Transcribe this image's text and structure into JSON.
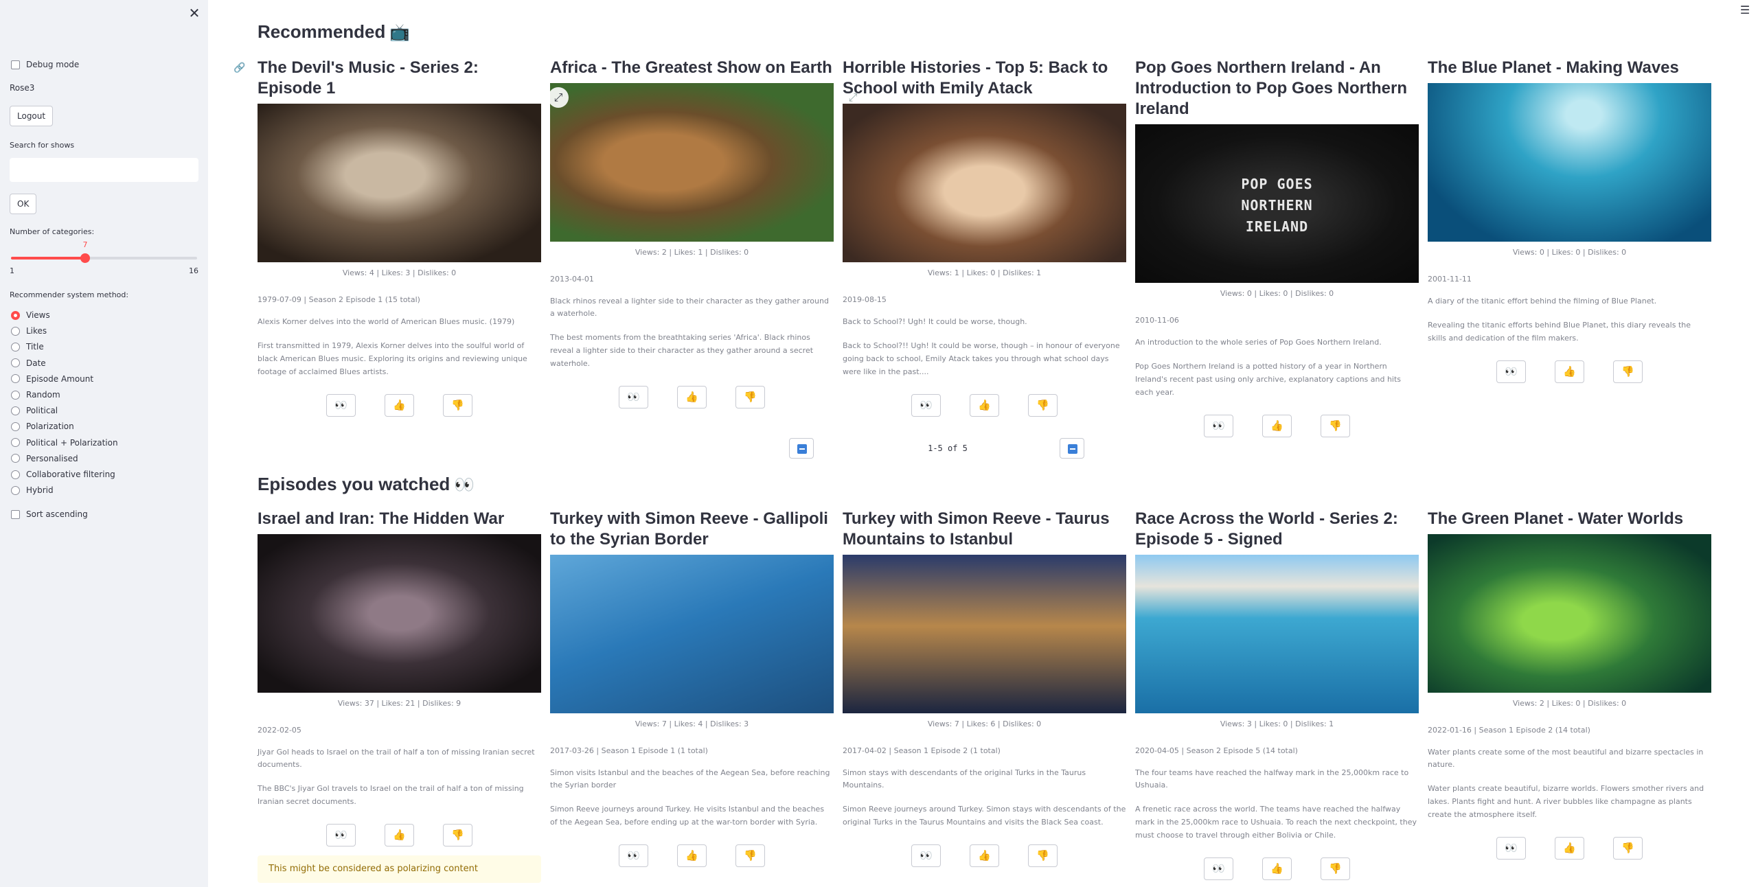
{
  "sidebar": {
    "debug_label": "Debug mode",
    "user_name": "Rose3",
    "logout_label": "Logout",
    "search_label": "Search for shows",
    "search_placeholder": "",
    "ok_label": "OK",
    "categories_label": "Number of categories:",
    "slider": {
      "value": "7",
      "min": "1",
      "max": "16"
    },
    "method_label": "Recommender system method:",
    "methods": [
      "Views",
      "Likes",
      "Title",
      "Date",
      "Episode Amount",
      "Random",
      "Political",
      "Polarization",
      "Political + Polarization",
      "Personalised",
      "Collaborative filtering",
      "Hybrid"
    ],
    "selected_method": "Views",
    "sort_label": "Sort ascending"
  },
  "accent_color": "#ff4b4b",
  "sections": {
    "recommended": {
      "title": "Recommended",
      "emoji": "📺"
    },
    "watched": {
      "title": "Episodes you watched",
      "emoji": "👀"
    }
  },
  "pager": {
    "text": "1-5 of 5"
  },
  "actions": {
    "watch": "👀",
    "like": "👍",
    "dislike": "👎"
  },
  "recommended": [
    {
      "title": "The Devil's Music - Series 2: Episode 1",
      "stats": "Views: 4 | Likes: 3 | Dislikes: 0",
      "date": "1979-07-09 | Season 2 Episode 1 (15 total)",
      "short": "Alexis Korner delves into the world of American Blues music. (1979)",
      "long": "First transmitted in 1979, Alexis Korner delves into the soulful world of black American Blues music. Exploring its origins and reviewing unique footage of acclaimed Blues artists."
    },
    {
      "title": "Africa - The Greatest Show on Earth",
      "stats": "Views: 2 | Likes: 1 | Dislikes: 0",
      "date": "2013-04-01",
      "short": "Black rhinos reveal a lighter side to their character as they gather around a waterhole.",
      "long": "The best moments from the breathtaking series 'Africa'. Black rhinos reveal a lighter side to their character as they gather around a secret waterhole."
    },
    {
      "title": "Horrible Histories - Top 5: Back to School with Emily Atack",
      "stats": "Views: 1 | Likes: 0 | Dislikes: 1",
      "date": "2019-08-15",
      "short": "Back to School?! Ugh! It could be worse, though.",
      "long": "Back to School?!! Ugh! It could be worse, though – in honour of everyone going back to school, Emily Atack takes you through what school days were like in the past...."
    },
    {
      "title": "Pop Goes Northern Ireland - An Introduction to Pop Goes Northern Ireland",
      "stats": "Views: 0 | Likes: 0 | Dislikes: 0",
      "date": "2010-11-06",
      "short": "An introduction to the whole series of Pop Goes Northern Ireland.",
      "long": "Pop Goes Northern Ireland is a potted history of a year in Northern Ireland's recent past using only archive, explanatory captions and hits each year."
    },
    {
      "title": "The Blue Planet - Making Waves",
      "stats": "Views: 0 | Likes: 0 | Dislikes: 0",
      "date": "2001-11-11",
      "short": "A diary of the titanic effort behind the filming of Blue Planet.",
      "long": "Revealing the titanic efforts behind Blue Planet, this diary reveals the skills and dedication of the film makers."
    }
  ],
  "watched": [
    {
      "title": "Israel and Iran: The Hidden War",
      "stats": "Views: 37 | Likes: 21 | Dislikes: 9",
      "date": "2022-02-05",
      "short": "Jiyar Gol heads to Israel on the trail of half a ton of missing Iranian secret documents.",
      "long": "The BBC's Jiyar Gol travels to Israel on the trail of half a ton of missing Iranian secret documents.",
      "warning": "This might be considered as polarizing content"
    },
    {
      "title": "Turkey with Simon Reeve - Gallipoli to the Syrian Border",
      "stats": "Views: 7 | Likes: 4 | Dislikes: 3",
      "date": "2017-03-26 | Season 1 Episode 1 (1 total)",
      "short": "Simon visits Istanbul and the beaches of the Aegean Sea, before reaching the Syrian border",
      "long": "Simon Reeve journeys around Turkey. He visits Istanbul and the beaches of the Aegean Sea, before ending up at the war-torn border with Syria."
    },
    {
      "title": "Turkey with Simon Reeve - Taurus Mountains to Istanbul",
      "stats": "Views: 7 | Likes: 6 | Dislikes: 0",
      "date": "2017-04-02 | Season 1 Episode 2 (1 total)",
      "short": "Simon stays with descendants of the original Turks in the Taurus Mountains.",
      "long": "Simon Reeve journeys around Turkey. Simon stays with descendants of the original Turks in the Taurus Mountains and visits the Black Sea coast."
    },
    {
      "title": "Race Across the World - Series 2: Episode 5 - Signed",
      "stats": "Views: 3 | Likes: 0 | Dislikes: 1",
      "date": "2020-04-05 | Season 2 Episode 5 (14 total)",
      "short": "The four teams have reached the halfway mark in the 25,000km race to Ushuaia.",
      "long": "A frenetic race across the world. The teams have reached the halfway mark in the 25,000km race to Ushuaia. To reach the next checkpoint, they must choose to travel through either Bolivia or Chile."
    },
    {
      "title": "The Green Planet - Water Worlds",
      "stats": "Views: 2 | Likes: 0 | Dislikes: 0",
      "date": "2022-01-16 | Season 1 Episode 2 (14 total)",
      "short": "Water plants create some of the most beautiful and bizarre spectacles in nature.",
      "long": "Water plants create beautiful, bizarre worlds. Flowers smother rivers and lakes. Plants fight and hunt. A river bubbles like champagne as plants create the atmosphere itself."
    }
  ]
}
